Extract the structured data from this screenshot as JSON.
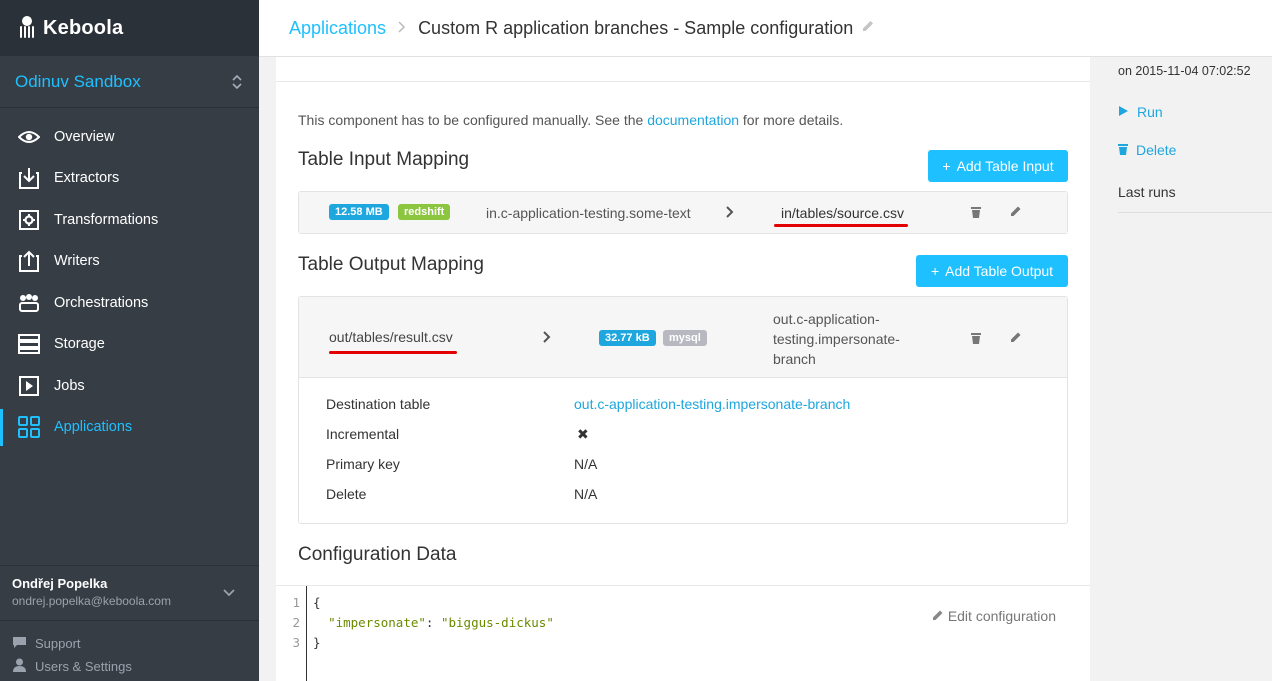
{
  "sidebar": {
    "logo_text": "Keboola",
    "project_name": "Odinuv Sandbox",
    "items": [
      {
        "label": "Overview",
        "icon": "eye-icon"
      },
      {
        "label": "Extractors",
        "icon": "download-icon"
      },
      {
        "label": "Transformations",
        "icon": "gear-icon"
      },
      {
        "label": "Writers",
        "icon": "upload-icon"
      },
      {
        "label": "Orchestrations",
        "icon": "orchestration-icon"
      },
      {
        "label": "Storage",
        "icon": "storage-icon"
      },
      {
        "label": "Jobs",
        "icon": "play-icon"
      },
      {
        "label": "Applications",
        "icon": "apps-grid-icon",
        "active": true
      }
    ],
    "user": {
      "name": "Ondřej Popelka",
      "email": "ondrej.popelka@keboola.com"
    },
    "footer": {
      "support": "Support",
      "settings": "Users & Settings"
    }
  },
  "header": {
    "breadcrumb_link": "Applications",
    "title": "Custom R application branches - Sample configuration"
  },
  "main": {
    "notice_prefix": "This component has to be configured manually. See the",
    "notice_link": "documentation",
    "notice_suffix": "for more details.",
    "input_mapping": {
      "heading": "Table Input Mapping",
      "add_button": "Add Table Input",
      "row": {
        "size": "12.58 MB",
        "backend": "redshift",
        "source": "in.c-application-testing.some-text",
        "destination": "in/tables/source.csv"
      }
    },
    "output_mapping": {
      "heading": "Table Output Mapping",
      "add_button": "Add Table Output",
      "row": {
        "source": "out/tables/result.csv",
        "size": "32.77 kB",
        "backend": "mysql",
        "destination_line1": "out.c-application-",
        "destination_line2": "testing.impersonate-",
        "destination_line3": "branch"
      },
      "details": {
        "destination_table_label": "Destination table",
        "destination_table_value": "out.c-application-testing.impersonate-branch",
        "incremental_label": "Incremental",
        "incremental_value": "✖",
        "primary_key_label": "Primary key",
        "primary_key_value": "N/A",
        "delete_label": "Delete",
        "delete_value": "N/A"
      }
    },
    "configuration": {
      "heading": "Configuration Data",
      "line_numbers": [
        "1",
        "2",
        "3"
      ],
      "line1": "{",
      "key": "\"impersonate\"",
      "colon": ": ",
      "value": "\"biggus-dickus\"",
      "line3": "}",
      "edit_button": "Edit configuration"
    }
  },
  "right": {
    "date": "on 2015-11-04 07:02:52",
    "run": "Run",
    "delete": "Delete",
    "last_runs": "Last runs"
  },
  "colors": {
    "accent": "#1ec0ff",
    "sidebar": "#363d45",
    "annotation_red": "#e30000"
  }
}
